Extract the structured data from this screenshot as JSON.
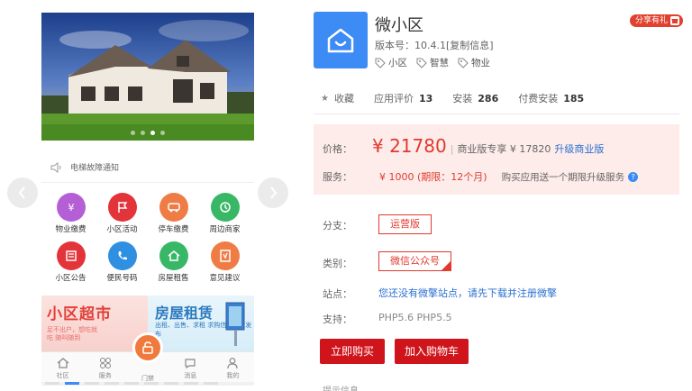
{
  "preview": {
    "notice_text": "电梯故障通知",
    "grid": [
      {
        "label": "物业缴费",
        "icon": "wallet-icon",
        "color": "#b45fd6"
      },
      {
        "label": "小区活动",
        "icon": "flag-icon",
        "color": "#e3343a"
      },
      {
        "label": "停车缴费",
        "icon": "car-icon",
        "color": "#ef7c45"
      },
      {
        "label": "周边商家",
        "icon": "shop-icon",
        "color": "#38b866"
      },
      {
        "label": "小区公告",
        "icon": "notice-icon",
        "color": "#e3343a"
      },
      {
        "label": "便民号码",
        "icon": "phone-icon",
        "color": "#2f8fe0"
      },
      {
        "label": "房屋租售",
        "icon": "house-icon",
        "color": "#38b866"
      },
      {
        "label": "意见建议",
        "icon": "feedback-icon",
        "color": "#ef7c45"
      }
    ],
    "banner_left": {
      "title": "小区超市",
      "sub": "足不出户，想吃就吃 随叫随到"
    },
    "banner_right": {
      "title": "房屋租赁",
      "sub": "出租、出售、求租 求购信息随时发布"
    },
    "tabs": [
      {
        "label": "社区",
        "icon": "home-icon"
      },
      {
        "label": "服务",
        "icon": "grid-icon"
      },
      {
        "label": "门禁",
        "icon": "unlock-icon"
      },
      {
        "label": "消息",
        "icon": "chat-icon"
      },
      {
        "label": "我的",
        "icon": "user-icon"
      }
    ]
  },
  "app": {
    "name": "微小区",
    "version": "版本号：10.4.1[复制信息]",
    "tags": [
      "小区",
      "智慧",
      "物业"
    ],
    "share": "分享有礼",
    "brand_color": "#3d8bf4"
  },
  "stats": {
    "favorite": "收藏",
    "rating_label": "应用评价",
    "rating": "13",
    "install_label": "安装",
    "install": "286",
    "paid_label": "付费安装",
    "paid": "185"
  },
  "pricing": {
    "price_label": "价格：",
    "price": "¥ 21780",
    "edition_text": "商业版专享 ¥ 17820",
    "upgrade_link": "升级商业版",
    "service_label": "服务：",
    "service_fee": "¥ 1000 (期限：12个月)",
    "service_note": "购买应用送一个期限升级服务",
    "accent": "#e03a2f"
  },
  "options": {
    "branch_label": "分支：",
    "branch_value": "运营版",
    "category_label": "类别：",
    "category_value": "微信公众号",
    "site_label": "站点：",
    "site_text": "您还没有微擎站点，请先下载并注册微擎",
    "support_label": "支持：",
    "support_text": "PHP5.6  PHP5.5"
  },
  "actions": {
    "buy": "立即购买",
    "cart": "加入购物车"
  },
  "more_heading": "提示信息"
}
